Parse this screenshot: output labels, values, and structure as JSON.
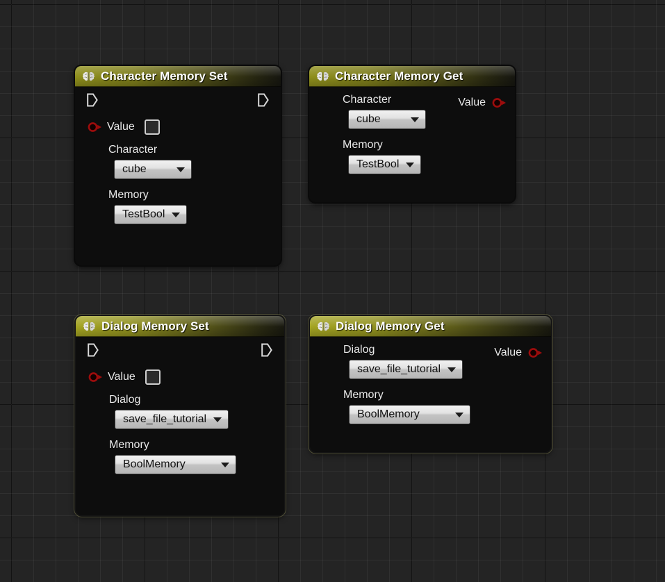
{
  "canvas": {
    "background_color": "#242424",
    "grid_minor_color": "#2e2e2e",
    "grid_major_color": "#0a0a0a"
  },
  "theme": {
    "title_accent": "#8f8f1c",
    "title_accent_bright": "#a4a422",
    "node_body": "#0d0d0d",
    "bool_pin_color": "#8b0000",
    "exec_pin_color": "#d8d8d8",
    "combo_color": "#e2e2e2"
  },
  "nodes": [
    {
      "id": "character-memory-set",
      "title": "Character Memory Set",
      "icon": "brain-icon",
      "selected": false,
      "exec_in": true,
      "exec_out": true,
      "value_pin": {
        "label": "Value",
        "direction": "input",
        "type": "bool",
        "checked": false
      },
      "fields": [
        {
          "label": "Character",
          "value": "cube"
        },
        {
          "label": "Memory",
          "value": "TestBool"
        }
      ]
    },
    {
      "id": "character-memory-get",
      "title": "Character Memory Get",
      "icon": "brain-icon",
      "selected": false,
      "exec_in": false,
      "exec_out": false,
      "value_pin": {
        "label": "Value",
        "direction": "output",
        "type": "bool"
      },
      "fields": [
        {
          "label": "Character",
          "value": "cube"
        },
        {
          "label": "Memory",
          "value": "TestBool"
        }
      ]
    },
    {
      "id": "dialog-memory-set",
      "title": "Dialog Memory Set",
      "icon": "brain-icon",
      "selected": true,
      "exec_in": true,
      "exec_out": true,
      "value_pin": {
        "label": "Value",
        "direction": "input",
        "type": "bool",
        "checked": false
      },
      "fields": [
        {
          "label": "Dialog",
          "value": "save_file_tutorial"
        },
        {
          "label": "Memory",
          "value": "BoolMemory"
        }
      ]
    },
    {
      "id": "dialog-memory-get",
      "title": "Dialog Memory Get",
      "icon": "brain-icon",
      "selected": true,
      "exec_in": false,
      "exec_out": false,
      "value_pin": {
        "label": "Value",
        "direction": "output",
        "type": "bool"
      },
      "fields": [
        {
          "label": "Dialog",
          "value": "save_file_tutorial"
        },
        {
          "label": "Memory",
          "value": "BoolMemory"
        }
      ]
    }
  ]
}
